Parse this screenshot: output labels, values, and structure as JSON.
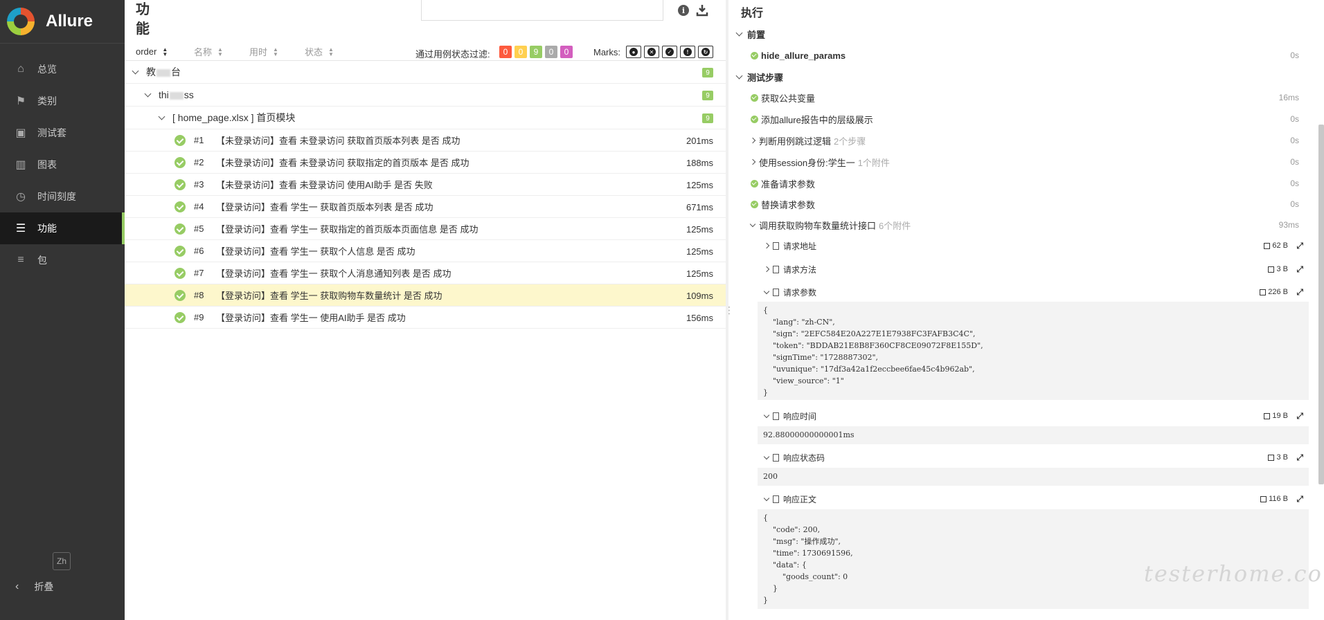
{
  "app": {
    "brand": "Allure"
  },
  "sidebar": {
    "items": [
      {
        "label": "总览",
        "icon": "home-icon"
      },
      {
        "label": "类别",
        "icon": "flag-icon"
      },
      {
        "label": "测试套",
        "icon": "briefcase-icon"
      },
      {
        "label": "图表",
        "icon": "bar-chart-icon"
      },
      {
        "label": "时间刻度",
        "icon": "clock-icon"
      },
      {
        "label": "功能",
        "icon": "list-icon",
        "active": true
      },
      {
        "label": "包",
        "icon": "align-left-icon"
      }
    ],
    "lang": "Zh",
    "collapse": "折叠"
  },
  "middle": {
    "title": "功能",
    "sort": {
      "order": "order",
      "name": "名称",
      "duration": "用时",
      "status": "状态"
    },
    "filter_label": "通过用例状态过滤:",
    "badges": [
      {
        "value": "0",
        "color": "#fd5a3e"
      },
      {
        "value": "0",
        "color": "#ffd050"
      },
      {
        "value": "9",
        "color": "#97cc64"
      },
      {
        "value": "0",
        "color": "#aaaaaa"
      },
      {
        "value": "0",
        "color": "#d35ebe"
      }
    ],
    "marks_label": "Marks:",
    "tree": {
      "level1": {
        "label_prefix": "教",
        "label_suffix": "台",
        "count": "9"
      },
      "level2": {
        "label_prefix": "thi",
        "label_suffix": "ss",
        "count": "9"
      },
      "level3": {
        "label": "[ home_page.xlsx ] 首页模块",
        "count": "9"
      },
      "tests": [
        {
          "num": "#1",
          "name": "【未登录访问】查看 未登录访问 获取首页版本列表 是否 成功",
          "dur": "201ms"
        },
        {
          "num": "#2",
          "name": "【未登录访问】查看 未登录访问 获取指定的首页版本 是否 成功",
          "dur": "188ms"
        },
        {
          "num": "#3",
          "name": "【未登录访问】查看 未登录访问 使用AI助手 是否 失败",
          "dur": "125ms"
        },
        {
          "num": "#4",
          "name": "【登录访问】查看 学生一 获取首页版本列表 是否 成功",
          "dur": "671ms"
        },
        {
          "num": "#5",
          "name": "【登录访问】查看 学生一 获取指定的首页版本页面信息 是否 成功",
          "dur": "125ms"
        },
        {
          "num": "#6",
          "name": "【登录访问】查看 学生一 获取个人信息 是否 成功",
          "dur": "125ms"
        },
        {
          "num": "#7",
          "name": "【登录访问】查看 学生一 获取个人消息通知列表 是否 成功",
          "dur": "125ms"
        },
        {
          "num": "#8",
          "name": "【登录访问】查看 学生一 获取购物车数量统计 是否 成功",
          "dur": "109ms"
        },
        {
          "num": "#9",
          "name": "【登录访问】查看 学生一 使用AI助手 是否 成功",
          "dur": "156ms"
        }
      ]
    }
  },
  "execution": {
    "title": "执行",
    "setup": "前置",
    "setup_step": {
      "name": "hide_allure_params",
      "dur": "0s"
    },
    "steps_title": "测试步骤",
    "steps": [
      {
        "name": "获取公共变量",
        "extra": "",
        "dur": "16ms"
      },
      {
        "name": "添加allure报告中的层级展示",
        "extra": "",
        "dur": "0s"
      },
      {
        "name": "判断用例跳过逻辑",
        "extra": "2个步骤",
        "dur": "0s"
      },
      {
        "name": "使用session身份:学生一",
        "extra": "1个附件",
        "dur": "0s"
      },
      {
        "name": "准备请求参数",
        "extra": "",
        "dur": "0s"
      },
      {
        "name": "替换请求参数",
        "extra": "",
        "dur": "0s"
      },
      {
        "name": "调用获取购物车数量统计接口",
        "extra": "6个附件",
        "dur": "93ms"
      }
    ],
    "attachments": [
      {
        "name": "请求地址",
        "size": "62 B"
      },
      {
        "name": "请求方法",
        "size": "3 B"
      },
      {
        "name": "请求参数",
        "size": "226 B"
      },
      {
        "name": "响应时间",
        "size": "19 B"
      },
      {
        "name": "响应状态码",
        "size": "3 B"
      },
      {
        "name": "响应正文",
        "size": "116 B"
      }
    ],
    "request_params": "{\n    \"lang\": \"zh-CN\",\n    \"sign\": \"2EFC584E20A227E1E7938FC3FAFB3C4C\",\n    \"token\": \"BDDAB21E8B8F360CF8CE09072F8E155D\",\n    \"signTime\": \"1728887302\",\n    \"uvunique\": \"17df3a42a1f2eccbee6fae45c4b962ab\",\n    \"view_source\": \"1\"\n}",
    "response_time": "92.88000000000001ms",
    "status_code": "200",
    "response_body": "{\n    \"code\": 200,\n    \"msg\": \"操作成功\",\n    \"time\": 1730691596,\n    \"data\": {\n        \"goods_count\": 0\n    }\n}"
  },
  "watermark": "testerhome.com"
}
